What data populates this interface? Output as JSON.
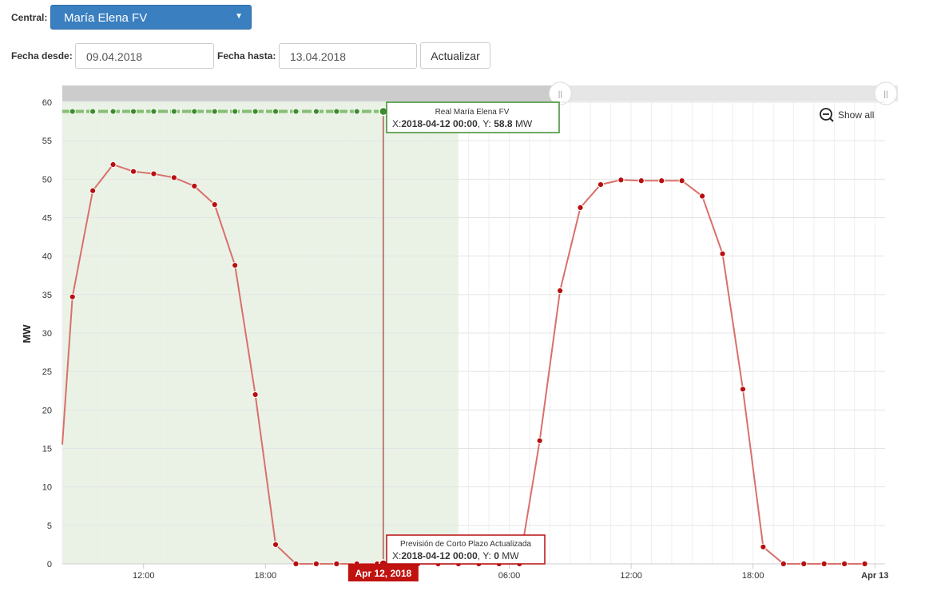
{
  "controls": {
    "central_label": "Central:",
    "central_value": "María Elena FV",
    "fecha_desde_label": "Fecha desde:",
    "fecha_desde_value": "09.04.2018",
    "fecha_hasta_label": "Fecha hasta:",
    "fecha_hasta_value": "13.04.2018",
    "actualizar_label": "Actualizar"
  },
  "toolbar": {
    "show_all_label": "Show all",
    "zoom_icon": "zoom-out-icon"
  },
  "navigator": {
    "handle_glyph": "||",
    "range_start_fraction": 0.0,
    "range_end_fraction": 0.58
  },
  "crosshair_label": "Apr 12, 2018",
  "tooltips": [
    {
      "title": "Real María Elena FV",
      "x_prefix": "X:",
      "x_value": "2018-04-12 00:00",
      "y_prefix": ", Y: ",
      "y_value": "58.8",
      "unit": "MW",
      "color": "#3c8c2c"
    },
    {
      "title": "Previsión de Corto Plazo Actualizada",
      "x_prefix": "X:",
      "x_value": "2018-04-12 00:00",
      "y_prefix": ", Y: ",
      "y_value": "0",
      "unit": "MW",
      "color": "#b80f0f"
    }
  ],
  "chart_data": {
    "type": "line",
    "ylabel": "MW",
    "ylim": [
      0,
      60
    ],
    "yticks": [
      0,
      5,
      10,
      15,
      20,
      25,
      30,
      35,
      40,
      45,
      50,
      55,
      60
    ],
    "xlim": [
      8.0,
      48.5
    ],
    "xticks": [
      {
        "x": 12,
        "label": "12:00"
      },
      {
        "x": 18,
        "label": "18:00"
      },
      {
        "x": 30,
        "label": "06:00"
      },
      {
        "x": 36,
        "label": "12:00"
      },
      {
        "x": 42,
        "label": "18:00"
      },
      {
        "x": 48,
        "label": "Apr 13"
      }
    ],
    "x_unit_note": "x values are hours from 2018-04-11 00:00",
    "grid": true,
    "shaded_region": {
      "x_start": 8.0,
      "x_end": 27.5,
      "color": "#eaf2e6"
    },
    "crosshair_x": 23.8,
    "series": [
      {
        "name": "Previsión de Corto Plazo Actualizada",
        "color": "#d9706b",
        "marker_color": "#b80f0f",
        "points": [
          [
            8.0,
            15.5
          ],
          [
            8.5,
            34.7
          ],
          [
            9.5,
            48.5
          ],
          [
            10.5,
            51.9
          ],
          [
            11.5,
            51.0
          ],
          [
            12.5,
            50.7
          ],
          [
            13.5,
            50.2
          ],
          [
            14.5,
            49.1
          ],
          [
            15.5,
            46.7
          ],
          [
            16.5,
            38.8
          ],
          [
            17.5,
            22.0
          ],
          [
            18.5,
            2.5
          ],
          [
            19.5,
            0
          ],
          [
            20.5,
            0
          ],
          [
            21.5,
            0
          ],
          [
            22.5,
            0
          ],
          [
            23.5,
            0
          ],
          [
            24.5,
            0
          ],
          [
            25.5,
            0
          ],
          [
            26.5,
            0
          ],
          [
            27.5,
            0
          ],
          [
            28.5,
            0
          ],
          [
            29.5,
            0
          ],
          [
            30.5,
            0
          ],
          [
            31.5,
            16.0
          ],
          [
            32.5,
            35.5
          ],
          [
            33.5,
            46.3
          ],
          [
            34.5,
            49.3
          ],
          [
            35.5,
            49.9
          ],
          [
            36.5,
            49.8
          ],
          [
            37.5,
            49.8
          ],
          [
            38.5,
            49.8
          ],
          [
            39.5,
            47.8
          ],
          [
            40.5,
            40.3
          ],
          [
            41.5,
            22.7
          ],
          [
            42.5,
            2.2
          ],
          [
            43.5,
            0
          ],
          [
            44.5,
            0
          ],
          [
            45.5,
            0
          ],
          [
            46.5,
            0
          ],
          [
            47.5,
            0
          ]
        ]
      },
      {
        "name": "Real María Elena FV",
        "color": "#5aa843",
        "marker_color": "#3c8c2c",
        "points": [
          [
            8.0,
            58.8
          ],
          [
            8.5,
            58.8
          ],
          [
            9.5,
            58.8
          ],
          [
            10.5,
            58.8
          ],
          [
            11.5,
            58.8
          ],
          [
            12.5,
            58.8
          ],
          [
            13.5,
            58.8
          ],
          [
            14.5,
            58.8
          ],
          [
            15.5,
            58.8
          ],
          [
            16.5,
            58.8
          ],
          [
            17.5,
            58.8
          ],
          [
            18.5,
            58.8
          ],
          [
            19.5,
            58.8
          ],
          [
            20.5,
            58.8
          ],
          [
            21.5,
            58.8
          ],
          [
            22.5,
            58.8
          ],
          [
            23.8,
            58.8
          ],
          [
            24.5,
            58.8
          ],
          [
            25.5,
            58.8
          ],
          [
            26.5,
            58.8
          ]
        ]
      }
    ]
  }
}
